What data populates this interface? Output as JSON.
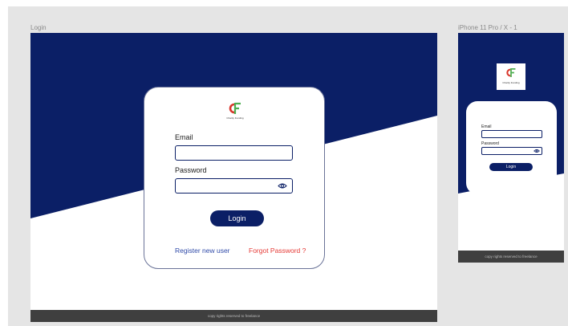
{
  "desktop": {
    "frame_label": "Login",
    "logo_text": "Charity Funding",
    "email_label": "Email",
    "email_value": "",
    "password_label": "Password",
    "password_value": "",
    "login_button": "Login",
    "register_link": "Register new user",
    "forgot_link": "Forgot Password ?",
    "footer": "copy rights reserved  to freelance"
  },
  "mobile": {
    "frame_label": "iPhone 11 Pro / X - 1",
    "logo_text": "Charity Funding",
    "email_label": "Email",
    "email_value": "",
    "password_label": "Password",
    "password_value": "",
    "login_button": "Login",
    "footer": "copy rights reserved  to freelance"
  },
  "colors": {
    "navy": "#0b1f66",
    "link_blue": "#2f4aa8",
    "forgot_red": "#e53935",
    "logo_red": "#d9362b",
    "logo_green": "#4caf50",
    "footer_bg": "#3f3f3f"
  }
}
